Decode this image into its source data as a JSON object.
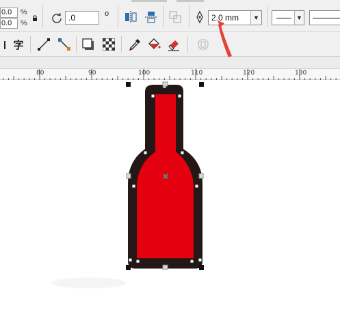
{
  "size_fields": {
    "width_value": "0.0",
    "height_value": "0.0",
    "width_unit": "%",
    "height_unit": "%"
  },
  "rotation": {
    "value": ".0"
  },
  "outline": {
    "width_value": "2.0 mm"
  },
  "ruler": {
    "labels": [
      "80",
      "90",
      "100",
      "110",
      "120",
      "130"
    ]
  },
  "icons": {
    "lock": "lock-icon",
    "rotate": "rotate-icon",
    "mirror_h": "mirror-horizontal-icon",
    "mirror_v": "mirror-vertical-icon",
    "pen": "pen-nib-icon",
    "text": "text-icon",
    "line": "line-tool-icon",
    "connector": "connector-tool-icon",
    "drop_shadow": "drop-shadow-icon",
    "transparency": "transparency-icon",
    "eyedropper": "eyedropper-icon",
    "fill_bucket": "fill-bucket-icon",
    "eraser": "eraser-icon"
  },
  "colors": {
    "fill": "#e3000f",
    "outline": "#231815",
    "annotation_arrow": "#e8413a",
    "center_marker": "#2fa8a0"
  }
}
